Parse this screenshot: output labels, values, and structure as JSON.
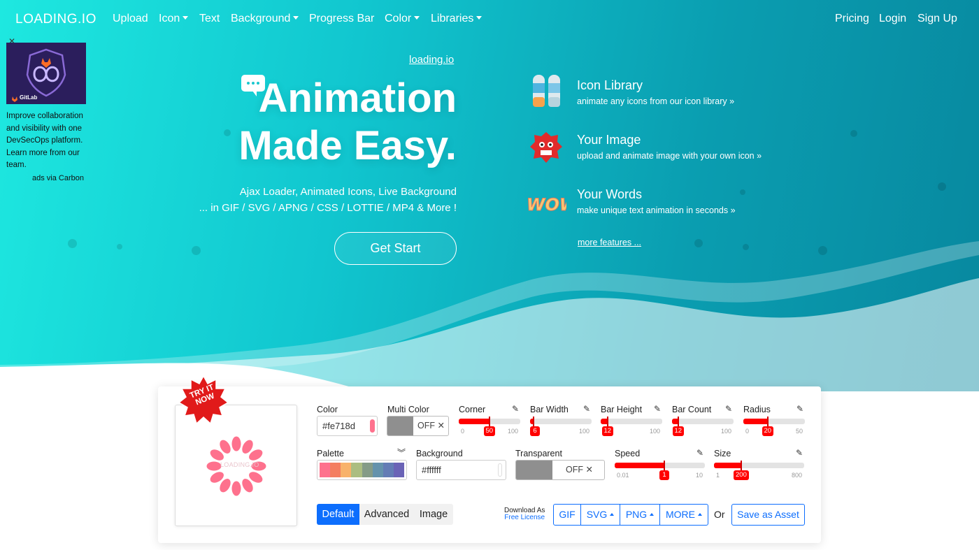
{
  "nav": {
    "logo": "LOADING.IO",
    "items": [
      "Upload",
      "Icon",
      "Text",
      "Background",
      "Progress Bar",
      "Color",
      "Libraries"
    ],
    "right_items": [
      "Pricing",
      "Login",
      "Sign Up"
    ]
  },
  "ad": {
    "close": "✕",
    "brand": "GitLab",
    "text": "Improve collaboration and visibility with one DevSecOps platform. Learn more from our team.",
    "via": "ads via Carbon"
  },
  "hero": {
    "site_link": "loading.io",
    "headline_line1": "Animation",
    "headline_line2": "Made Easy.",
    "subtitle_line1": "Ajax Loader, Animated Icons, Live Background",
    "subtitle_line2": "... in GIF / SVG / APNG / CSS / LOTTIE / MP4 & More !",
    "cta": "Get Start"
  },
  "features": [
    {
      "icon": "icon-library-icon",
      "title": "Icon Library",
      "desc": "animate any icons from our icon library »"
    },
    {
      "icon": "your-image-icon",
      "title": "Your Image",
      "desc": "upload and animate image with your own icon »"
    },
    {
      "icon": "wow-text-icon",
      "title": "Your Words",
      "desc": "make unique text animation in seconds »"
    }
  ],
  "more_features": "more features ...",
  "editor": {
    "badge": "TRY IT NOW",
    "watermark": "LOADING.IO",
    "color": {
      "label": "Color",
      "value": "#fe718d"
    },
    "multi_color": {
      "label": "Multi Color",
      "state": "OFF ✕"
    },
    "palette": {
      "label": "Palette",
      "colors": [
        "#fe718d",
        "#f47e60",
        "#f8b26a",
        "#abbd81",
        "#849b87",
        "#6492ac",
        "#637cb5",
        "#6a63b6"
      ]
    },
    "background": {
      "label": "Background",
      "value": "#ffffff"
    },
    "transparent": {
      "label": "Transparent",
      "state": "OFF ✕"
    },
    "sliders": [
      {
        "label": "Corner",
        "min": "0",
        "max": "100",
        "value": "50",
        "frac": 0.5
      },
      {
        "label": "Bar Width",
        "min": "0",
        "max": "100",
        "value": "6",
        "frac": 0.06
      },
      {
        "label": "Bar Height",
        "min": "1",
        "max": "100",
        "value": "12",
        "frac": 0.11
      },
      {
        "label": "Bar Count",
        "min": "2",
        "max": "100",
        "value": "12",
        "frac": 0.1
      },
      {
        "label": "Radius",
        "min": "0",
        "max": "50",
        "value": "20",
        "frac": 0.4
      },
      {
        "label": "Speed",
        "min": "0.01",
        "max": "10",
        "value": "1",
        "frac": 0.55
      },
      {
        "label": "Size",
        "min": "1",
        "max": "800",
        "value": "200",
        "frac": 0.3
      }
    ],
    "tabs": [
      "Default",
      "Advanced",
      "Image"
    ],
    "download_as": "Download As",
    "free_license": "Free License",
    "formats": [
      "GIF",
      "SVG",
      "PNG",
      "MORE"
    ],
    "or": "Or",
    "save_asset": "Save as Asset",
    "spinner_color": "#fe718d"
  }
}
